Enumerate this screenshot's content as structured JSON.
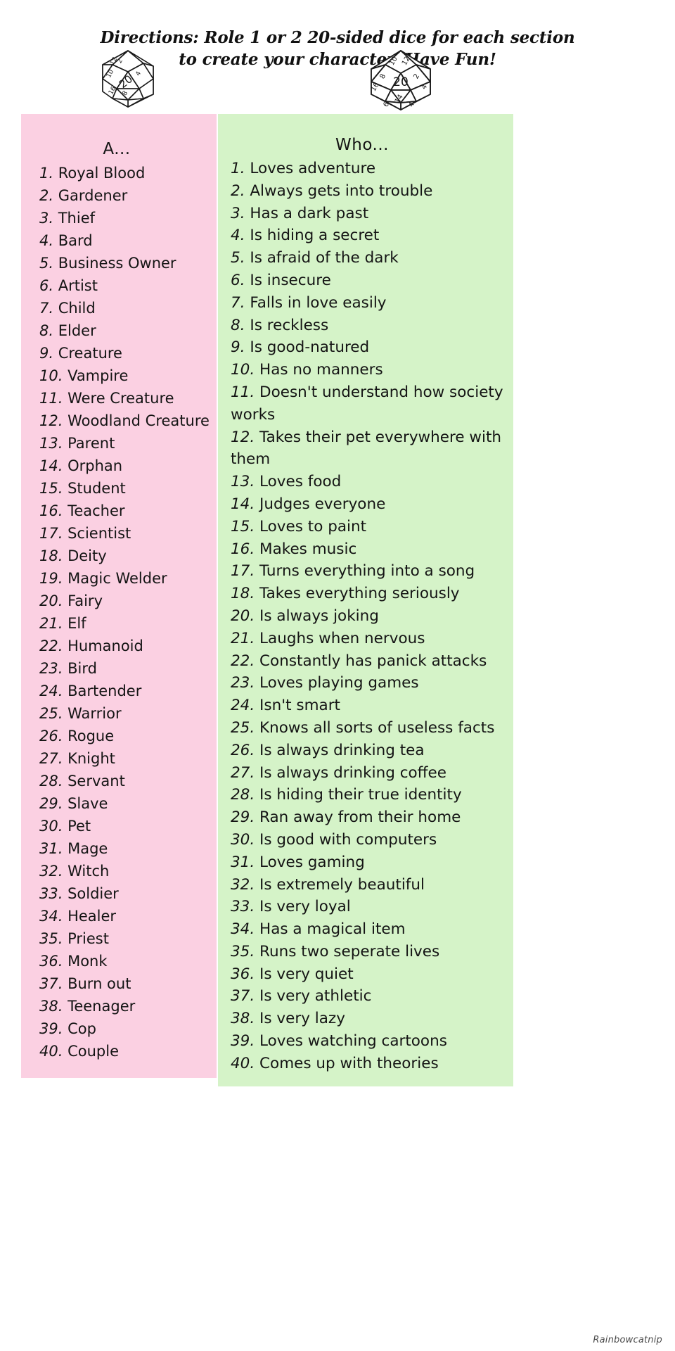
{
  "header": {
    "directions": "Directions: Role 1 or 2 20-sided dice for each section to create your character. Have Fun!",
    "dice": [
      {
        "name": "d20-die-left",
        "face_value": "20"
      },
      {
        "name": "d20-die-right",
        "face_value": "20"
      }
    ]
  },
  "columns": [
    {
      "id": "a",
      "heading": "A...",
      "background_color": "#fbd0e2",
      "entries": [
        {
          "num": "1.",
          "text": "Royal Blood"
        },
        {
          "num": "2.",
          "text": "Gardener"
        },
        {
          "num": "3.",
          "text": "Thief"
        },
        {
          "num": "4.",
          "text": "Bard"
        },
        {
          "num": "5.",
          "text": "Business Owner"
        },
        {
          "num": "6.",
          "text": "Artist"
        },
        {
          "num": "7.",
          "text": "Child"
        },
        {
          "num": "8.",
          "text": "Elder"
        },
        {
          "num": "9.",
          "text": "Creature"
        },
        {
          "num": "10.",
          "text": "Vampire"
        },
        {
          "num": "11.",
          "text": "Were Creature"
        },
        {
          "num": "12.",
          "text": "Woodland Creature"
        },
        {
          "num": "13.",
          "text": "Parent"
        },
        {
          "num": "14.",
          "text": "Orphan"
        },
        {
          "num": "15.",
          "text": "Student"
        },
        {
          "num": "16.",
          "text": "Teacher"
        },
        {
          "num": "17.",
          "text": "Scientist"
        },
        {
          "num": "18.",
          "text": "Deity"
        },
        {
          "num": "19.",
          "text": "Magic Welder"
        },
        {
          "num": "20.",
          "text": "Fairy"
        },
        {
          "num": "21.",
          "text": "Elf"
        },
        {
          "num": "22.",
          "text": "Humanoid"
        },
        {
          "num": "23.",
          "text": "Bird"
        },
        {
          "num": "24.",
          "text": "Bartender"
        },
        {
          "num": "25.",
          "text": "Warrior"
        },
        {
          "num": "26.",
          "text": "Rogue"
        },
        {
          "num": "27.",
          "text": "Knight"
        },
        {
          "num": "28.",
          "text": "Servant"
        },
        {
          "num": "29.",
          "text": "Slave"
        },
        {
          "num": "30.",
          "text": "Pet"
        },
        {
          "num": "31.",
          "text": "Mage"
        },
        {
          "num": "32.",
          "text": "Witch"
        },
        {
          "num": "33.",
          "text": "Soldier"
        },
        {
          "num": "34.",
          "text": "Healer"
        },
        {
          "num": "35.",
          "text": "Priest"
        },
        {
          "num": "36.",
          "text": "Monk"
        },
        {
          "num": "37.",
          "text": "Burn out"
        },
        {
          "num": "38.",
          "text": "Teenager"
        },
        {
          "num": "39.",
          "text": "Cop"
        },
        {
          "num": "40.",
          "text": "Couple"
        }
      ]
    },
    {
      "id": "who",
      "heading": "Who...",
      "background_color": "#d5f3c8",
      "entries": [
        {
          "num": "1.",
          "text": "Loves adventure"
        },
        {
          "num": "2.",
          "text": "Always gets into trouble"
        },
        {
          "num": "3.",
          "text": "Has a dark past"
        },
        {
          "num": "4.",
          "text": "Is hiding a secret"
        },
        {
          "num": "5.",
          "text": "Is afraid of the dark"
        },
        {
          "num": "6.",
          "text": "Is insecure"
        },
        {
          "num": "7.",
          "text": "Falls in love easily"
        },
        {
          "num": "8.",
          "text": "Is reckless"
        },
        {
          "num": "9.",
          "text": "Is good-natured"
        },
        {
          "num": "10.",
          "text": "Has no manners"
        },
        {
          "num": "11.",
          "text": "Doesn't understand how society works"
        },
        {
          "num": "12.",
          "text": "Takes their pet everywhere with them"
        },
        {
          "num": "13.",
          "text": "Loves food"
        },
        {
          "num": "14.",
          "text": "Judges everyone"
        },
        {
          "num": "15.",
          "text": "Loves to paint"
        },
        {
          "num": "16.",
          "text": "Makes music"
        },
        {
          "num": "17.",
          "text": "Turns everything into a song"
        },
        {
          "num": "18.",
          "text": "Takes everything seriously"
        },
        {
          "num": "20.",
          "text": "Is always joking"
        },
        {
          "num": "21.",
          "text": "Laughs when nervous"
        },
        {
          "num": "22.",
          "text": "Constantly has panick attacks"
        },
        {
          "num": "23.",
          "text": "Loves playing games"
        },
        {
          "num": "24.",
          "text": "Isn't smart"
        },
        {
          "num": "25.",
          "text": "Knows all sorts of useless facts"
        },
        {
          "num": "26.",
          "text": "Is always drinking tea"
        },
        {
          "num": "27.",
          "text": "Is always drinking coffee"
        },
        {
          "num": "28.",
          "text": "Is hiding their true identity"
        },
        {
          "num": "29.",
          "text": "Ran away from their home"
        },
        {
          "num": "30.",
          "text": "Is good with computers"
        },
        {
          "num": "31.",
          "text": "Loves gaming"
        },
        {
          "num": "32.",
          "text": "Is extremely beautiful"
        },
        {
          "num": "33.",
          "text": "Is very loyal"
        },
        {
          "num": "34.",
          "text": "Has a magical item"
        },
        {
          "num": "35.",
          "text": "Runs two seperate lives"
        },
        {
          "num": "36.",
          "text": "Is very quiet"
        },
        {
          "num": "37.",
          "text": "Is very athletic"
        },
        {
          "num": "38.",
          "text": "Is very lazy"
        },
        {
          "num": "39.",
          "text": "Loves watching cartoons"
        },
        {
          "num": "40.",
          "text": "Comes up with theories"
        }
      ]
    }
  ],
  "watermark": "Rainbowcatnip"
}
